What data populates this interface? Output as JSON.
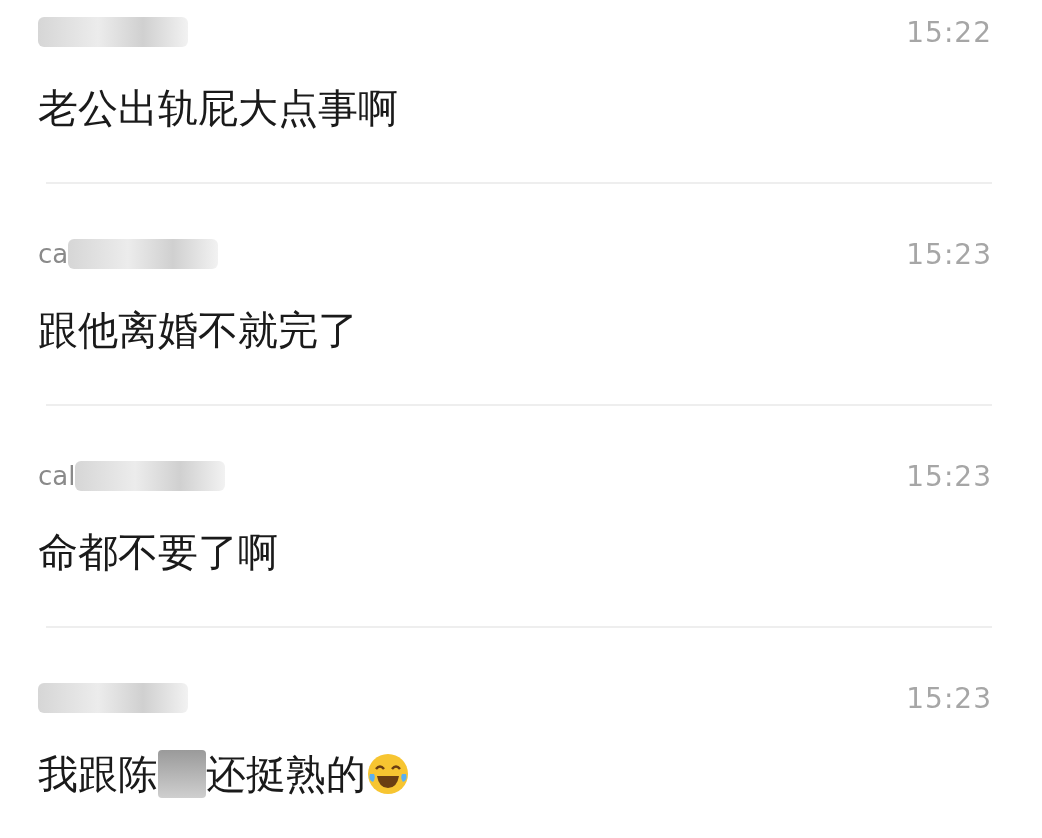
{
  "comments": [
    {
      "time": "15:22",
      "message": [
        {
          "kind": "text",
          "text": "老公出轨屁大点事啊"
        }
      ]
    },
    {
      "name": "ca",
      "time": "15:23",
      "message": [
        {
          "kind": "text",
          "text": "跟他离婚不就完了"
        }
      ]
    },
    {
      "name": "cal",
      "time": "15:23",
      "message": [
        {
          "kind": "text",
          "text": "命都不要了啊"
        }
      ]
    },
    {
      "time": "15:23",
      "message": [
        {
          "kind": "text",
          "text": "我跟陈"
        },
        {
          "kind": "redacted"
        },
        {
          "kind": "text",
          "text": "还挺熟的"
        },
        {
          "kind": "emoji"
        }
      ]
    }
  ]
}
